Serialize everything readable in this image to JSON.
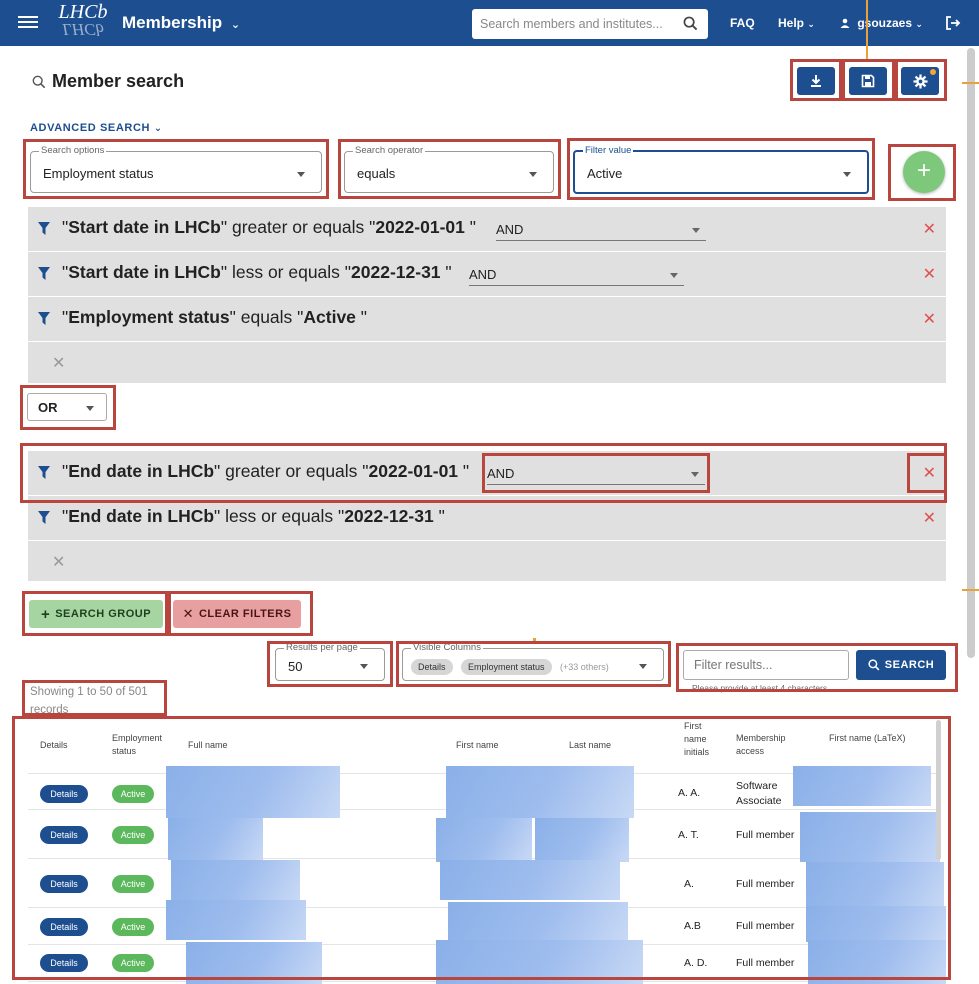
{
  "topbar": {
    "logo_text_1": "LHCb",
    "logo_text_2": "LHCb",
    "app_title": "Membership",
    "search_placeholder": "Search members and institutes...",
    "faq": "FAQ",
    "help": "Help",
    "user": "gsouzaes"
  },
  "header": {
    "title": "Member search",
    "advanced_search": "ADVANCED SEARCH"
  },
  "search_bar": {
    "options_legend": "Search options",
    "options_value": "Employment status",
    "operator_legend": "Search operator",
    "operator_value": "equals",
    "value_legend": "Filter value",
    "value_value": "Active"
  },
  "group1": {
    "filters": [
      {
        "q1": "\"",
        "field": "Start date in LHCb",
        "q2": "\"",
        "op_text": " greater or equals ",
        "q3": "\"",
        "value": "2022-01-01",
        "q4": " \"",
        "logic": "AND"
      },
      {
        "q1": "\"",
        "field": "Start date in LHCb",
        "q2": "\"",
        "op_text": " less or equals ",
        "q3": "\"",
        "value": "2022-12-31",
        "q4": " \"",
        "logic": "AND"
      },
      {
        "q1": "\"",
        "field": "Employment status",
        "q2": "\"",
        "op_text": " equals ",
        "q3": "\"",
        "value": "Active",
        "q4": " \""
      }
    ]
  },
  "group_operator": "OR",
  "group2": {
    "filters": [
      {
        "q1": "\"",
        "field": "End date in LHCb",
        "q2": "\"",
        "op_text": " greater or equals ",
        "q3": "\"",
        "value": "2022-01-01",
        "q4": " \"",
        "logic": "AND"
      },
      {
        "q1": "\"",
        "field": "End date in LHCb",
        "q2": "\"",
        "op_text": " less or equals ",
        "q3": "\"",
        "value": "2022-12-31",
        "q4": " \""
      }
    ]
  },
  "actions": {
    "search_group": "SEARCH GROUP",
    "clear_filters": "CLEAR FILTERS"
  },
  "results": {
    "per_page_legend": "Results per page",
    "per_page_value": "50",
    "columns_legend": "Visible Columns",
    "chip_details": "Details",
    "chip_employment": "Employment status",
    "chip_more": "(+33 others)",
    "filter_placeholder": "Filter results...",
    "filter_hint": "Please provide at least 4 characters",
    "search_label": "SEARCH",
    "showing": "Showing 1 to 50 of 501 records"
  },
  "table": {
    "headers": {
      "details": "Details",
      "employment": "Employment status",
      "full_name": "Full name",
      "first_name": "First name",
      "last_name": "Last name",
      "initials": "First name initials",
      "access": "Membership access",
      "latex": "First name (LaTeX)"
    },
    "rows": [
      {
        "details": "Details",
        "status": "Active",
        "initials": "A. A.",
        "access": "Software Associate"
      },
      {
        "details": "Details",
        "status": "Active",
        "initials": "A. T.",
        "access": "Full member"
      },
      {
        "details": "Details",
        "status": "Active",
        "initials": "A.",
        "access": "Full member"
      },
      {
        "details": "Details",
        "status": "Active",
        "initials": "A.B",
        "access": "Full member"
      },
      {
        "details": "Details",
        "status": "Active",
        "initials": "A. D.",
        "access": "Full member"
      }
    ]
  },
  "colors": {
    "brand": "#1d4e8f",
    "add_green": "#7dc87a",
    "active_green": "#5cb85c",
    "delete_red": "#e05050",
    "annotation": "#b8463e"
  }
}
